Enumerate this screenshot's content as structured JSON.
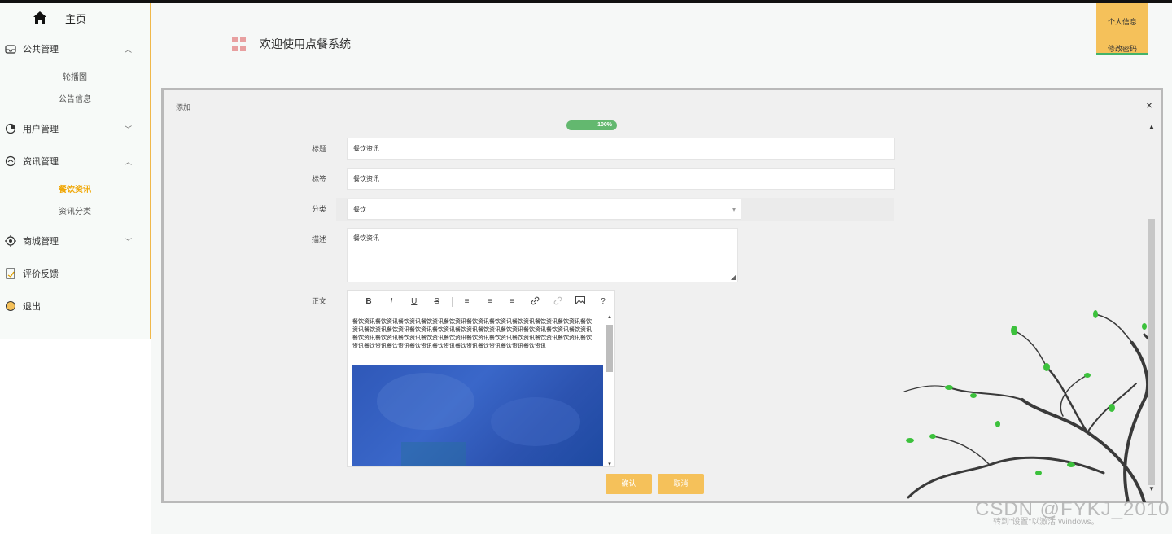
{
  "sidebar": {
    "home_label": "主页",
    "groups": [
      {
        "label": "公共管理",
        "chevron": "^",
        "icon": "mailbox-icon",
        "items": [
          "轮播图",
          "公告信息"
        ]
      },
      {
        "label": "用户管理",
        "chevron": "v",
        "icon": "user-circle-icon",
        "items": []
      },
      {
        "label": "资讯管理",
        "chevron": "^",
        "icon": "news-icon",
        "items": [
          "餐饮资讯",
          "资讯分类"
        ]
      },
      {
        "label": "商城管理",
        "chevron": "v",
        "icon": "shop-icon",
        "items": []
      },
      {
        "label": "评价反馈",
        "chevron": "",
        "icon": "feedback-icon",
        "items": []
      },
      {
        "label": "退出",
        "chevron": "",
        "icon": "exit-icon",
        "items": []
      }
    ],
    "active_item": "餐饮资讯",
    "accent_color": "#f0a500"
  },
  "header": {
    "title": "欢迎使用点餐系统",
    "user_menu": {
      "profile": "个人信息",
      "change_password": "修改密码"
    }
  },
  "dialog": {
    "title": "添加",
    "close": "×",
    "progress_label": "100%",
    "progress_value": 100,
    "form": {
      "title_label": "标题",
      "title_value": "餐饮资讯",
      "tag_label": "标签",
      "tag_value": "餐饮资讯",
      "category_label": "分类",
      "category_value": "餐饮",
      "desc_label": "描述",
      "desc_value": "餐饮资讯",
      "content_label": "正文",
      "content_text": "餐饮资讯餐饮资讯餐饮资讯餐饮资讯餐饮资讯餐饮资讯餐饮资讯餐饮资讯餐饮资讯餐饮资讯餐饮资讯餐饮资讯餐饮资讯餐饮资讯餐饮资讯餐饮资讯餐饮资讯餐饮资讯餐饮资讯餐饮资讯餐饮资讯餐饮资讯餐饮资讯餐饮资讯餐饮资讯餐饮资讯餐饮资讯餐饮资讯餐饮资讯餐饮资讯餐饮资讯餐饮资讯餐饮资讯餐饮资讯餐饮资讯餐饮资讯餐饮资讯餐饮资讯餐饮资讯餐饮资讯"
    },
    "toolbar": [
      "B",
      "I",
      "U",
      "S",
      "≡",
      "≡",
      "≡",
      "link",
      "unlink",
      "image",
      "?"
    ],
    "buttons": {
      "confirm": "确认",
      "cancel": "取消"
    }
  },
  "watermark": {
    "text": "CSDN @FYKJ_2010",
    "sub": "转到\"设置\"以激活 Windows。"
  },
  "colors": {
    "button": "#f5c15a",
    "progress": "#63b86f",
    "underline": "#43b36a"
  }
}
